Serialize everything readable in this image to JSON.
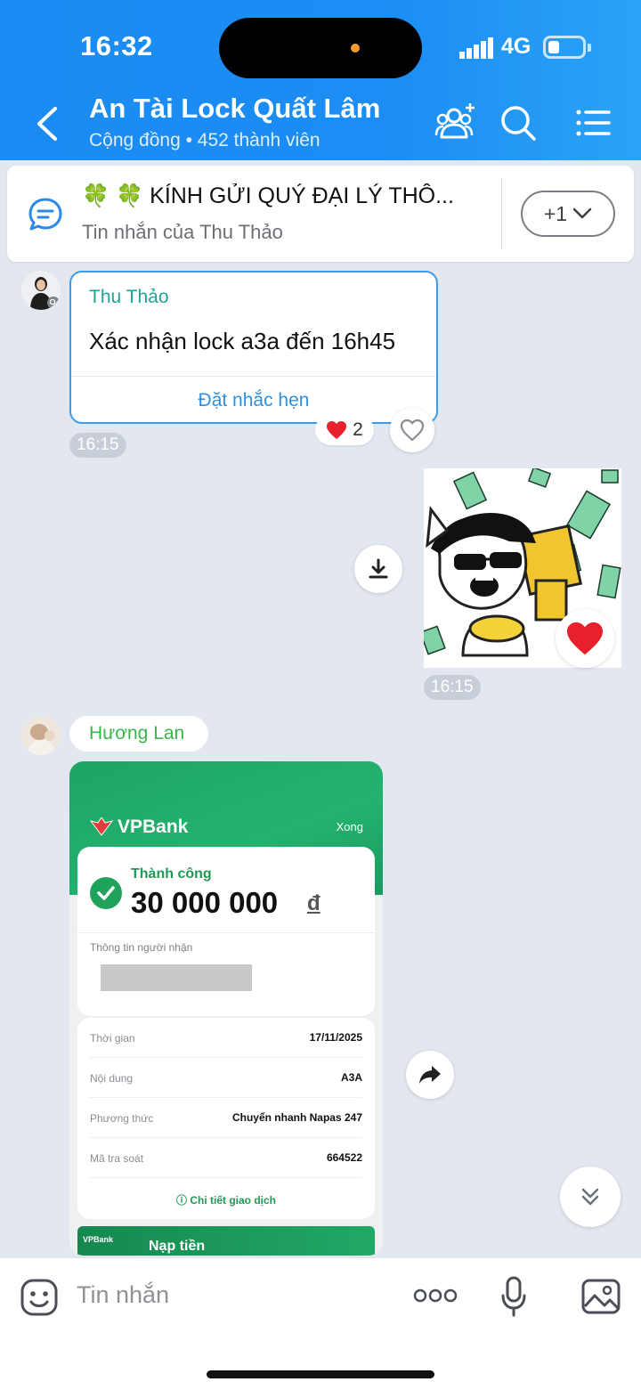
{
  "status_bar": {
    "time": "16:32",
    "network": "4G"
  },
  "header": {
    "title": "An Tài Lock Quất Lâm",
    "subtitle": "Cộng đồng • 452 thành viên"
  },
  "pinned": {
    "title": "🍀 🍀 KÍNH GỬI QUÝ ĐẠI LÝ THÔ...",
    "from": "Tin nhắn của Thu Thảo",
    "more_label": "+1"
  },
  "message1": {
    "sender": "Thu Thảo",
    "text": "Xác nhận lock a3a đến 16h45",
    "action": "Đặt nhắc hẹn",
    "time": "16:15",
    "reaction_count": "2"
  },
  "sticker_message": {
    "time": "16:15"
  },
  "message2": {
    "sender": "Hương Lan",
    "receipt": {
      "bank": "VPBank",
      "done_label": "Xong",
      "status": "Thành công",
      "amount": "30 000 000",
      "currency": "đ",
      "recipient_label": "Thông tin người nhận",
      "rows": [
        {
          "label": "Thời gian",
          "value": "17/11/2025"
        },
        {
          "label": "Nội dung",
          "value": "A3A"
        },
        {
          "label": "Phương thức",
          "value": "Chuyển nhanh Napas 247"
        },
        {
          "label": "Mã tra soát",
          "value": "664522"
        }
      ],
      "detail_link": "Chi tiết giao dịch",
      "banner_brand": "VPBank",
      "banner_text": "Nạp tiền"
    }
  },
  "composer": {
    "placeholder": "Tin nhắn"
  },
  "colors": {
    "header_blue": "#1a8bf2",
    "accent_green": "#1fa35a",
    "link_blue": "#2f8fe0"
  }
}
